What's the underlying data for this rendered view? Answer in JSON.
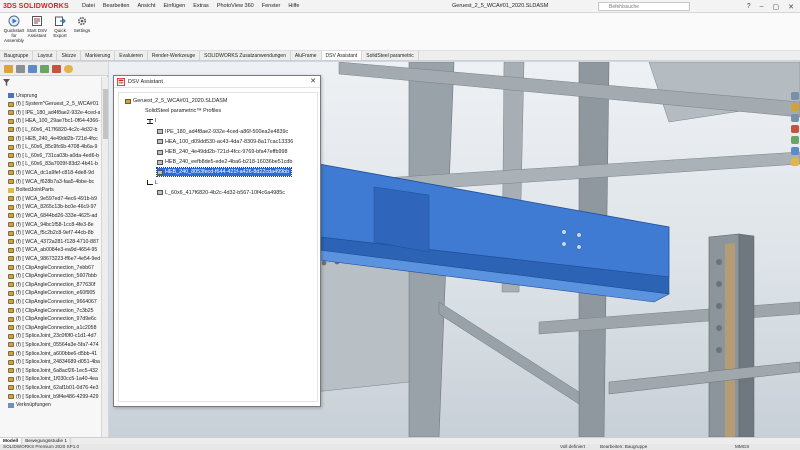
{
  "app": {
    "brand_ds": "3DS",
    "brand_name": "SOLIDWORKS",
    "document_title": "Geruest_2_5_WCA#01_2020.SLDASM",
    "search_placeholder": "Befehlssuche"
  },
  "menu": [
    "Datei",
    "Bearbeiten",
    "Ansicht",
    "Einfügen",
    "Extras",
    "PhotoView 360",
    "Fenster",
    "Hilfe"
  ],
  "ribbon": {
    "buttons": [
      {
        "label": "Quickstart for Assembly",
        "icon": "quickstart-icon"
      },
      {
        "label": "Start DSV Assistant",
        "icon": "dsv-assistant-icon"
      },
      {
        "label": "Quick Export",
        "icon": "export-icon"
      },
      {
        "label": "Settings",
        "icon": "gear-icon"
      }
    ]
  },
  "command_tabs": [
    {
      "label": "Baugruppe",
      "active": false
    },
    {
      "label": "Layout",
      "active": false
    },
    {
      "label": "Skizze",
      "active": false
    },
    {
      "label": "Markierung",
      "active": false
    },
    {
      "label": "Evaluieren",
      "active": false
    },
    {
      "label": "Render-Werkzeuge",
      "active": false
    },
    {
      "label": "SOLIDWORKS Zusatzanwendungen",
      "active": false
    },
    {
      "label": "AluFrame",
      "active": false
    },
    {
      "label": "DSV Assistant",
      "active": true
    },
    {
      "label": "SolidSteel parametric",
      "active": false
    }
  ],
  "feature_tree": [
    {
      "label": "Ursprung",
      "indent": 1,
      "kind": "origin"
    },
    {
      "label": "(f) [ System^Geruest_2_5_WCA#01",
      "indent": 1,
      "kind": "part"
    },
    {
      "label": "(f) [ IPE_180_ad4f8ae2-932e-4ced-a",
      "indent": 1,
      "kind": "part"
    },
    {
      "label": "(f) [ HEA_100_29ae7bc1-0f64-4366-a",
      "indent": 1,
      "kind": "part"
    },
    {
      "label": "(f) [ L_60x6_417f6820-4c2c-4d32-b",
      "indent": 1,
      "kind": "part"
    },
    {
      "label": "(f) [ HEB_240_4e49dd2b-721d-4fcc",
      "indent": 1,
      "kind": "part"
    },
    {
      "label": "(f) [ L_60x6_85c9fc6b-4708-4b6a-9",
      "indent": 1,
      "kind": "part"
    },
    {
      "label": "(f) [ L_60x6_731ca03b-a0da-4ed6-b",
      "indent": 1,
      "kind": "part"
    },
    {
      "label": "(f) [ L_60x6_83a7009f-83d2-4b41-b",
      "indent": 1,
      "kind": "part"
    },
    {
      "label": "(f) [ WCA_dc1a9fef-c818-4de8-9d",
      "indent": 1,
      "kind": "part"
    },
    {
      "label": "(f) [ WCA_f628b7a3-faa5-4bbe-bc",
      "indent": 1,
      "kind": "part"
    },
    {
      "label": "BoltedJointParts",
      "indent": 1,
      "kind": "folder"
    },
    {
      "label": "(f) [ WCA_9e597ed7-4ec6-491b-b9",
      "indent": 1,
      "kind": "part"
    },
    {
      "label": "(f) [ WCA_8265c13b-bc0e-46c9-97",
      "indent": 1,
      "kind": "part"
    },
    {
      "label": "(f) [ WCA_6844bd26-333e-4625-ad",
      "indent": 1,
      "kind": "part"
    },
    {
      "label": "(f) [ WCA_94bc1f58-1cc8-4fe3-8e",
      "indent": 1,
      "kind": "part"
    },
    {
      "label": "(f) [ WCA_f5c2b2c8-9ef7-44cb-8b",
      "indent": 1,
      "kind": "part"
    },
    {
      "label": "(f) [ WCA_4372a281-f128-4710-887",
      "indent": 1,
      "kind": "part"
    },
    {
      "label": "(f) [ WCA_ab0084e3-ea9d-4654-95",
      "indent": 1,
      "kind": "part"
    },
    {
      "label": "(f) [ WCA_98673223-ff6e7-4e54-9ed",
      "indent": 1,
      "kind": "part"
    },
    {
      "label": "(f) [ ClipAngleConnection_7ebb67",
      "indent": 1,
      "kind": "part"
    },
    {
      "label": "(f) [ ClipAngleConnection_5607bbb",
      "indent": 1,
      "kind": "part"
    },
    {
      "label": "(f) [ ClipAngleConnection_877630f",
      "indent": 1,
      "kind": "part"
    },
    {
      "label": "(f) [ ClipAngleConnection_e60f905",
      "indent": 1,
      "kind": "part"
    },
    {
      "label": "(f) [ ClipAngleConnection_9664067",
      "indent": 1,
      "kind": "part"
    },
    {
      "label": "(f) [ ClipAngleConnection_7c3b25",
      "indent": 1,
      "kind": "part"
    },
    {
      "label": "(f) [ ClipAngleConnection_97d9e6c",
      "indent": 1,
      "kind": "part"
    },
    {
      "label": "(f) [ ClipAngleConnection_a1c2058",
      "indent": 1,
      "kind": "part"
    },
    {
      "label": "(f) [ SpliceJoint_23c0f0f0-c1d1-4d7",
      "indent": 1,
      "kind": "part"
    },
    {
      "label": "(f) [ SpliceJoint_05564a3e-5fa7-474",
      "indent": 1,
      "kind": "part"
    },
    {
      "label": "(f) [ SpliceJoint_a600bbe6-d5bb-41",
      "indent": 1,
      "kind": "part"
    },
    {
      "label": "(f) [ SpliceJoint_24834689-d051-4ba",
      "indent": 1,
      "kind": "part"
    },
    {
      "label": "(f) [ SpliceJoint_6a8acf26-1ec5-432",
      "indent": 1,
      "kind": "part"
    },
    {
      "label": "(f) [ SpliceJoint_1f030cc5-1a40-4ea",
      "indent": 1,
      "kind": "part"
    },
    {
      "label": "(f) [ SpliceJoint_62af1b01-0d76-4e3",
      "indent": 1,
      "kind": "part"
    },
    {
      "label": "(f) [ SpliceJoint_b9f4e486-4299-429",
      "indent": 1,
      "kind": "part"
    },
    {
      "label": "Verknüpfungen",
      "indent": 1,
      "kind": "mates"
    }
  ],
  "dialog": {
    "title": "DSV Assistant",
    "close_glyph": "✕",
    "tree": [
      {
        "label": "Geruest_2_5_WCA#01_2020.SLDASM",
        "level": 0,
        "kind": "assembly",
        "selected": false
      },
      {
        "label": "SolidSteel parametric™ Profiles",
        "level": 1,
        "kind": "text",
        "selected": false
      },
      {
        "label": "I",
        "level": 2,
        "kind": "profile-i",
        "selected": false
      },
      {
        "label": "IPE_180_ad4f8ae2-932e-4ced-a86f-500ea2e4839c",
        "level": 3,
        "kind": "part",
        "selected": false
      },
      {
        "label": "HEA_100_d09dd530-ac43-4da7-8309-8a17cac13336",
        "level": 3,
        "kind": "part",
        "selected": false
      },
      {
        "label": "HEB_240_4e49dd2b-721d-4fcc-9769-bfa47effb998",
        "level": 3,
        "kind": "part",
        "selected": false
      },
      {
        "label": "HEB_240_eefb8de5-ede2-4ba6-b218-16036be51cdb",
        "level": 3,
        "kind": "part",
        "selected": false
      },
      {
        "label": "HEB_240_8053fecd-f644-421f-a426-8d22cda499bb",
        "level": 3,
        "kind": "part",
        "selected": true
      },
      {
        "label": "L",
        "level": 2,
        "kind": "profile-l",
        "selected": false
      },
      {
        "label": "L_60x6_417f6820-4b2c-4d32-b567-10f4c6a4985c",
        "level": 3,
        "kind": "part",
        "selected": false
      }
    ]
  },
  "bottom_tabs": [
    {
      "label": "Modell",
      "active": true
    },
    {
      "label": "Bewegungsstudie 1",
      "active": false
    }
  ],
  "status": {
    "product": "SOLIDWORKS Premium 2020 SP1.0",
    "defined": "Voll definiert",
    "mode": "Bearbeiten: Baugruppe",
    "units": "MMGS"
  },
  "colors": {
    "brand_red": "#d9201f",
    "selected_beam": "#3f7bd3",
    "steel": "#8f989f",
    "selection_highlight": "#2c6bd6"
  }
}
